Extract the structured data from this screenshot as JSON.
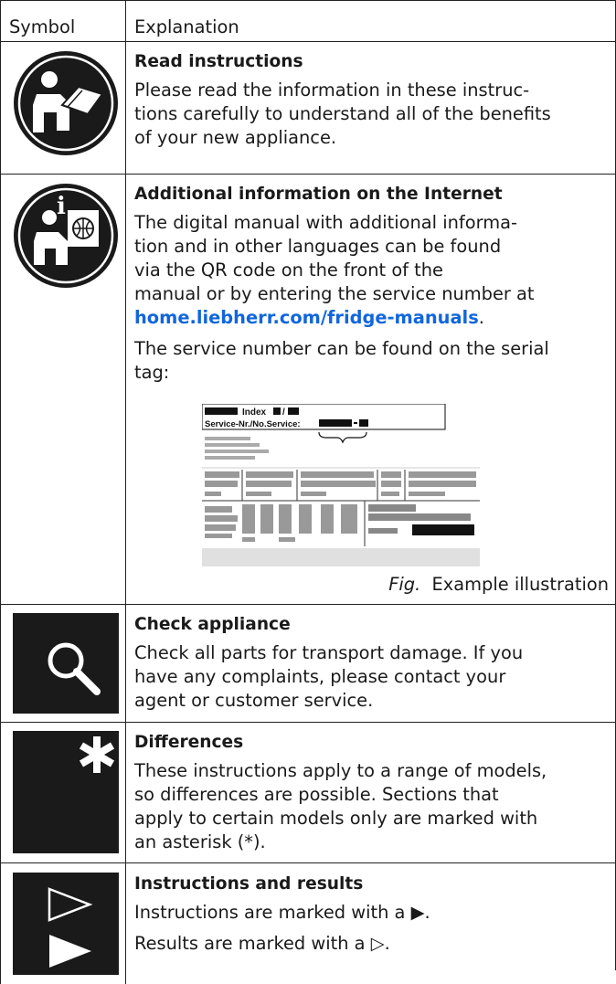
{
  "header": {
    "symbol": "Symbol",
    "explanation": "Explanation"
  },
  "rows": [
    {
      "icon": "read-instructions-icon",
      "title": "Read instructions",
      "lines": [
        "Please read the information in these instruc-",
        "tions carefully to understand all of the benefits",
        "of your new appliance."
      ]
    },
    {
      "icon": "internet-info-icon",
      "title": "Additional information on the Internet",
      "lines": [
        "The digital manual with additional informa-",
        "tion and in other languages can be found",
        "via the QR code on the front of the",
        "manual or by entering the service number at"
      ],
      "link": "home.liebherr.com/fridge-manuals",
      "link_suffix": ".",
      "serial_lines": [
        "The service number can be found on the serial",
        "tag:"
      ],
      "tag": {
        "index_label": "Index",
        "service_label": "Service-Nr./No.Service:"
      },
      "caption_fig": "Fig.",
      "caption_text": "Example illustration"
    },
    {
      "icon": "magnifier-icon",
      "title": "Check appliance",
      "lines": [
        "Check all parts for transport damage. If you",
        "have any complaints, please contact your",
        "agent or customer service."
      ]
    },
    {
      "icon": "asterisk-icon",
      "title": "Differences",
      "lines": [
        "These instructions apply to a range of models,",
        "so differences are possible. Sections that",
        "apply to certain models only are marked with",
        "an asterisk (*)."
      ]
    },
    {
      "icon": "instruction-arrows-icon",
      "title": "Instructions and results",
      "line1": "Instructions are marked with a ▶.",
      "line2": "Results are marked with a ▷."
    }
  ]
}
